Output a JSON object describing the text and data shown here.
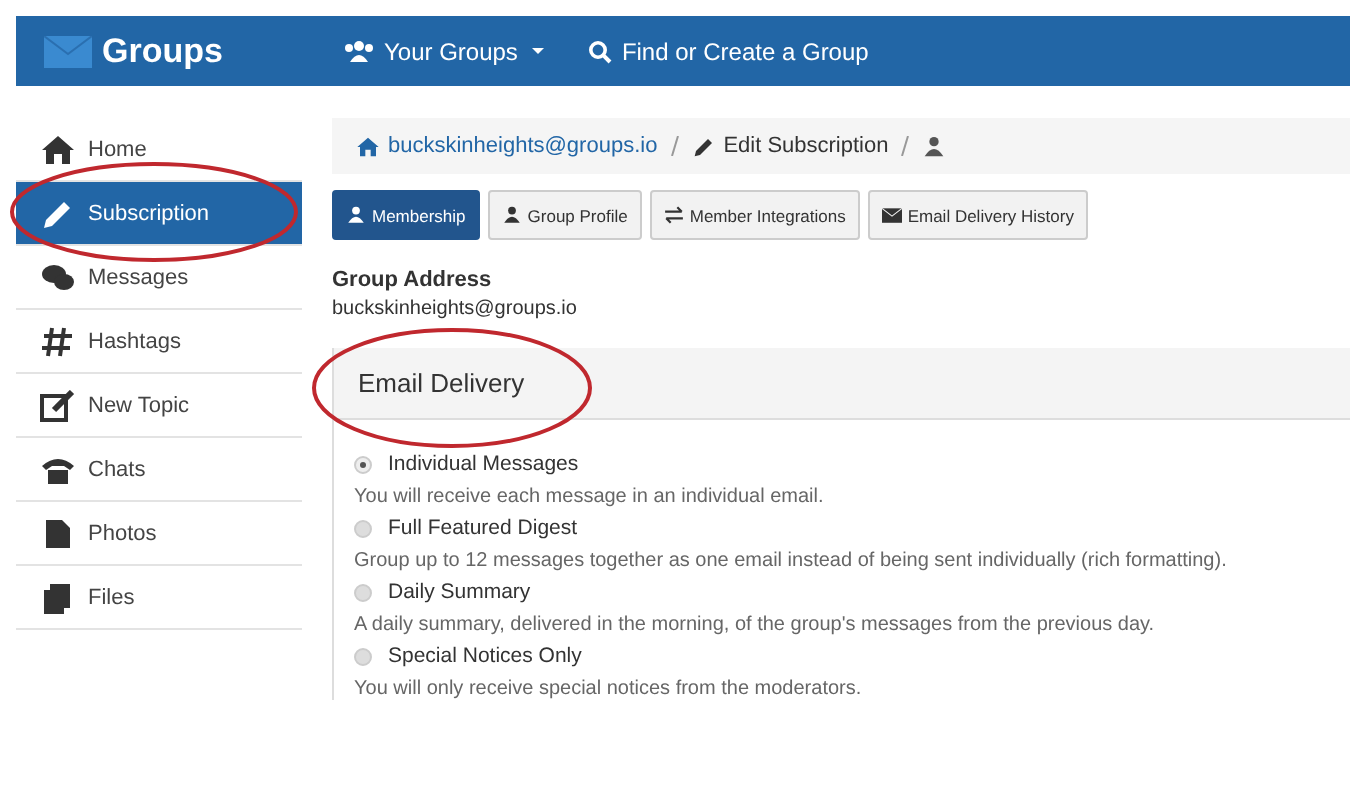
{
  "navbar": {
    "logo": "Groups",
    "menu": [
      {
        "label": "Your Groups",
        "kind": "dropdown"
      },
      {
        "label": "Find or Create a Group",
        "kind": "search"
      }
    ]
  },
  "sidebar": {
    "items": [
      {
        "label": "Home",
        "selected": false
      },
      {
        "label": "Subscription",
        "selected": true
      },
      {
        "label": "Messages",
        "selected": false
      },
      {
        "label": "Hashtags",
        "selected": false
      },
      {
        "label": "New Topic",
        "selected": false
      },
      {
        "label": "Chats",
        "selected": false
      },
      {
        "label": "Photos",
        "selected": false
      },
      {
        "label": "Files",
        "selected": false
      }
    ]
  },
  "breadcrumb": [
    {
      "label": "buckskinheights@groups.io"
    },
    {
      "label": "Edit Subscription"
    }
  ],
  "tabs": [
    {
      "label": "Membership",
      "selected": true
    },
    {
      "label": "Group Profile",
      "selected": false
    },
    {
      "label": "Member Integrations",
      "selected": false
    },
    {
      "label": "Email Delivery History",
      "selected": false
    }
  ],
  "group_address": {
    "label": "Group Address",
    "value": "buckskinheights@groups.io"
  },
  "email_delivery": {
    "title": "Email Delivery",
    "options": [
      {
        "label": "Individual Messages",
        "description": "You will receive each message in an individual email.",
        "selected": true
      },
      {
        "label": "Full Featured Digest",
        "description": "Group up to 12 messages together as one email instead of being sent individually (rich formatting).",
        "selected": false
      },
      {
        "label": "Daily Summary",
        "description": "A daily summary, delivered in the morning, of the group's messages from the previous day.",
        "selected": false
      },
      {
        "label": "Special Notices Only",
        "description": "You will only receive special notices from the moderators.",
        "selected": false
      }
    ]
  }
}
